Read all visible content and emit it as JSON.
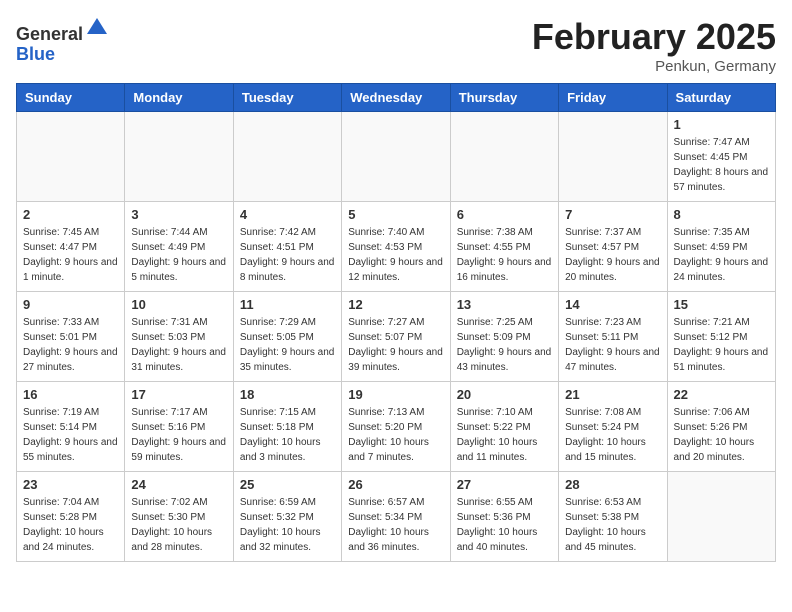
{
  "header": {
    "logo_line1": "General",
    "logo_line2": "Blue",
    "month_title": "February 2025",
    "location": "Penkun, Germany"
  },
  "weekdays": [
    "Sunday",
    "Monday",
    "Tuesday",
    "Wednesday",
    "Thursday",
    "Friday",
    "Saturday"
  ],
  "weeks": [
    [
      {
        "day": "",
        "info": ""
      },
      {
        "day": "",
        "info": ""
      },
      {
        "day": "",
        "info": ""
      },
      {
        "day": "",
        "info": ""
      },
      {
        "day": "",
        "info": ""
      },
      {
        "day": "",
        "info": ""
      },
      {
        "day": "1",
        "info": "Sunrise: 7:47 AM\nSunset: 4:45 PM\nDaylight: 8 hours and 57 minutes."
      }
    ],
    [
      {
        "day": "2",
        "info": "Sunrise: 7:45 AM\nSunset: 4:47 PM\nDaylight: 9 hours and 1 minute."
      },
      {
        "day": "3",
        "info": "Sunrise: 7:44 AM\nSunset: 4:49 PM\nDaylight: 9 hours and 5 minutes."
      },
      {
        "day": "4",
        "info": "Sunrise: 7:42 AM\nSunset: 4:51 PM\nDaylight: 9 hours and 8 minutes."
      },
      {
        "day": "5",
        "info": "Sunrise: 7:40 AM\nSunset: 4:53 PM\nDaylight: 9 hours and 12 minutes."
      },
      {
        "day": "6",
        "info": "Sunrise: 7:38 AM\nSunset: 4:55 PM\nDaylight: 9 hours and 16 minutes."
      },
      {
        "day": "7",
        "info": "Sunrise: 7:37 AM\nSunset: 4:57 PM\nDaylight: 9 hours and 20 minutes."
      },
      {
        "day": "8",
        "info": "Sunrise: 7:35 AM\nSunset: 4:59 PM\nDaylight: 9 hours and 24 minutes."
      }
    ],
    [
      {
        "day": "9",
        "info": "Sunrise: 7:33 AM\nSunset: 5:01 PM\nDaylight: 9 hours and 27 minutes."
      },
      {
        "day": "10",
        "info": "Sunrise: 7:31 AM\nSunset: 5:03 PM\nDaylight: 9 hours and 31 minutes."
      },
      {
        "day": "11",
        "info": "Sunrise: 7:29 AM\nSunset: 5:05 PM\nDaylight: 9 hours and 35 minutes."
      },
      {
        "day": "12",
        "info": "Sunrise: 7:27 AM\nSunset: 5:07 PM\nDaylight: 9 hours and 39 minutes."
      },
      {
        "day": "13",
        "info": "Sunrise: 7:25 AM\nSunset: 5:09 PM\nDaylight: 9 hours and 43 minutes."
      },
      {
        "day": "14",
        "info": "Sunrise: 7:23 AM\nSunset: 5:11 PM\nDaylight: 9 hours and 47 minutes."
      },
      {
        "day": "15",
        "info": "Sunrise: 7:21 AM\nSunset: 5:12 PM\nDaylight: 9 hours and 51 minutes."
      }
    ],
    [
      {
        "day": "16",
        "info": "Sunrise: 7:19 AM\nSunset: 5:14 PM\nDaylight: 9 hours and 55 minutes."
      },
      {
        "day": "17",
        "info": "Sunrise: 7:17 AM\nSunset: 5:16 PM\nDaylight: 9 hours and 59 minutes."
      },
      {
        "day": "18",
        "info": "Sunrise: 7:15 AM\nSunset: 5:18 PM\nDaylight: 10 hours and 3 minutes."
      },
      {
        "day": "19",
        "info": "Sunrise: 7:13 AM\nSunset: 5:20 PM\nDaylight: 10 hours and 7 minutes."
      },
      {
        "day": "20",
        "info": "Sunrise: 7:10 AM\nSunset: 5:22 PM\nDaylight: 10 hours and 11 minutes."
      },
      {
        "day": "21",
        "info": "Sunrise: 7:08 AM\nSunset: 5:24 PM\nDaylight: 10 hours and 15 minutes."
      },
      {
        "day": "22",
        "info": "Sunrise: 7:06 AM\nSunset: 5:26 PM\nDaylight: 10 hours and 20 minutes."
      }
    ],
    [
      {
        "day": "23",
        "info": "Sunrise: 7:04 AM\nSunset: 5:28 PM\nDaylight: 10 hours and 24 minutes."
      },
      {
        "day": "24",
        "info": "Sunrise: 7:02 AM\nSunset: 5:30 PM\nDaylight: 10 hours and 28 minutes."
      },
      {
        "day": "25",
        "info": "Sunrise: 6:59 AM\nSunset: 5:32 PM\nDaylight: 10 hours and 32 minutes."
      },
      {
        "day": "26",
        "info": "Sunrise: 6:57 AM\nSunset: 5:34 PM\nDaylight: 10 hours and 36 minutes."
      },
      {
        "day": "27",
        "info": "Sunrise: 6:55 AM\nSunset: 5:36 PM\nDaylight: 10 hours and 40 minutes."
      },
      {
        "day": "28",
        "info": "Sunrise: 6:53 AM\nSunset: 5:38 PM\nDaylight: 10 hours and 45 minutes."
      },
      {
        "day": "",
        "info": ""
      }
    ]
  ]
}
